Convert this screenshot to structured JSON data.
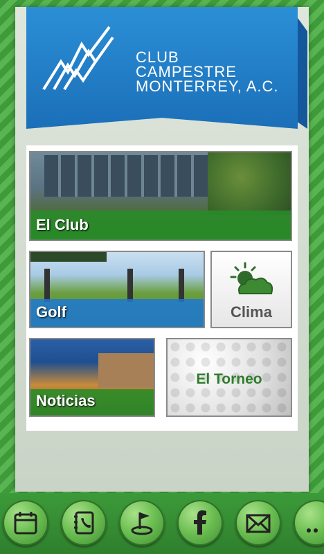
{
  "header": {
    "club_line1": "CLUB",
    "club_line2": "CAMPESTRE",
    "club_line3": "MONTERREY, A.C.",
    "logo_icon": "club-logo-icon"
  },
  "tiles": {
    "club": "El Club",
    "golf": "Golf",
    "clima": "Clima",
    "noticias": "Noticias",
    "torneo": "El Torneo"
  },
  "bottom_nav": [
    "calendar-icon",
    "phonebook-icon",
    "golf-hole-icon",
    "facebook-icon",
    "mail-icon",
    "more-icon"
  ],
  "colors": {
    "brand_blue": "#1b6fb8",
    "brand_green": "#3f9b3a",
    "tile_label_green": "#2f7d2a"
  }
}
